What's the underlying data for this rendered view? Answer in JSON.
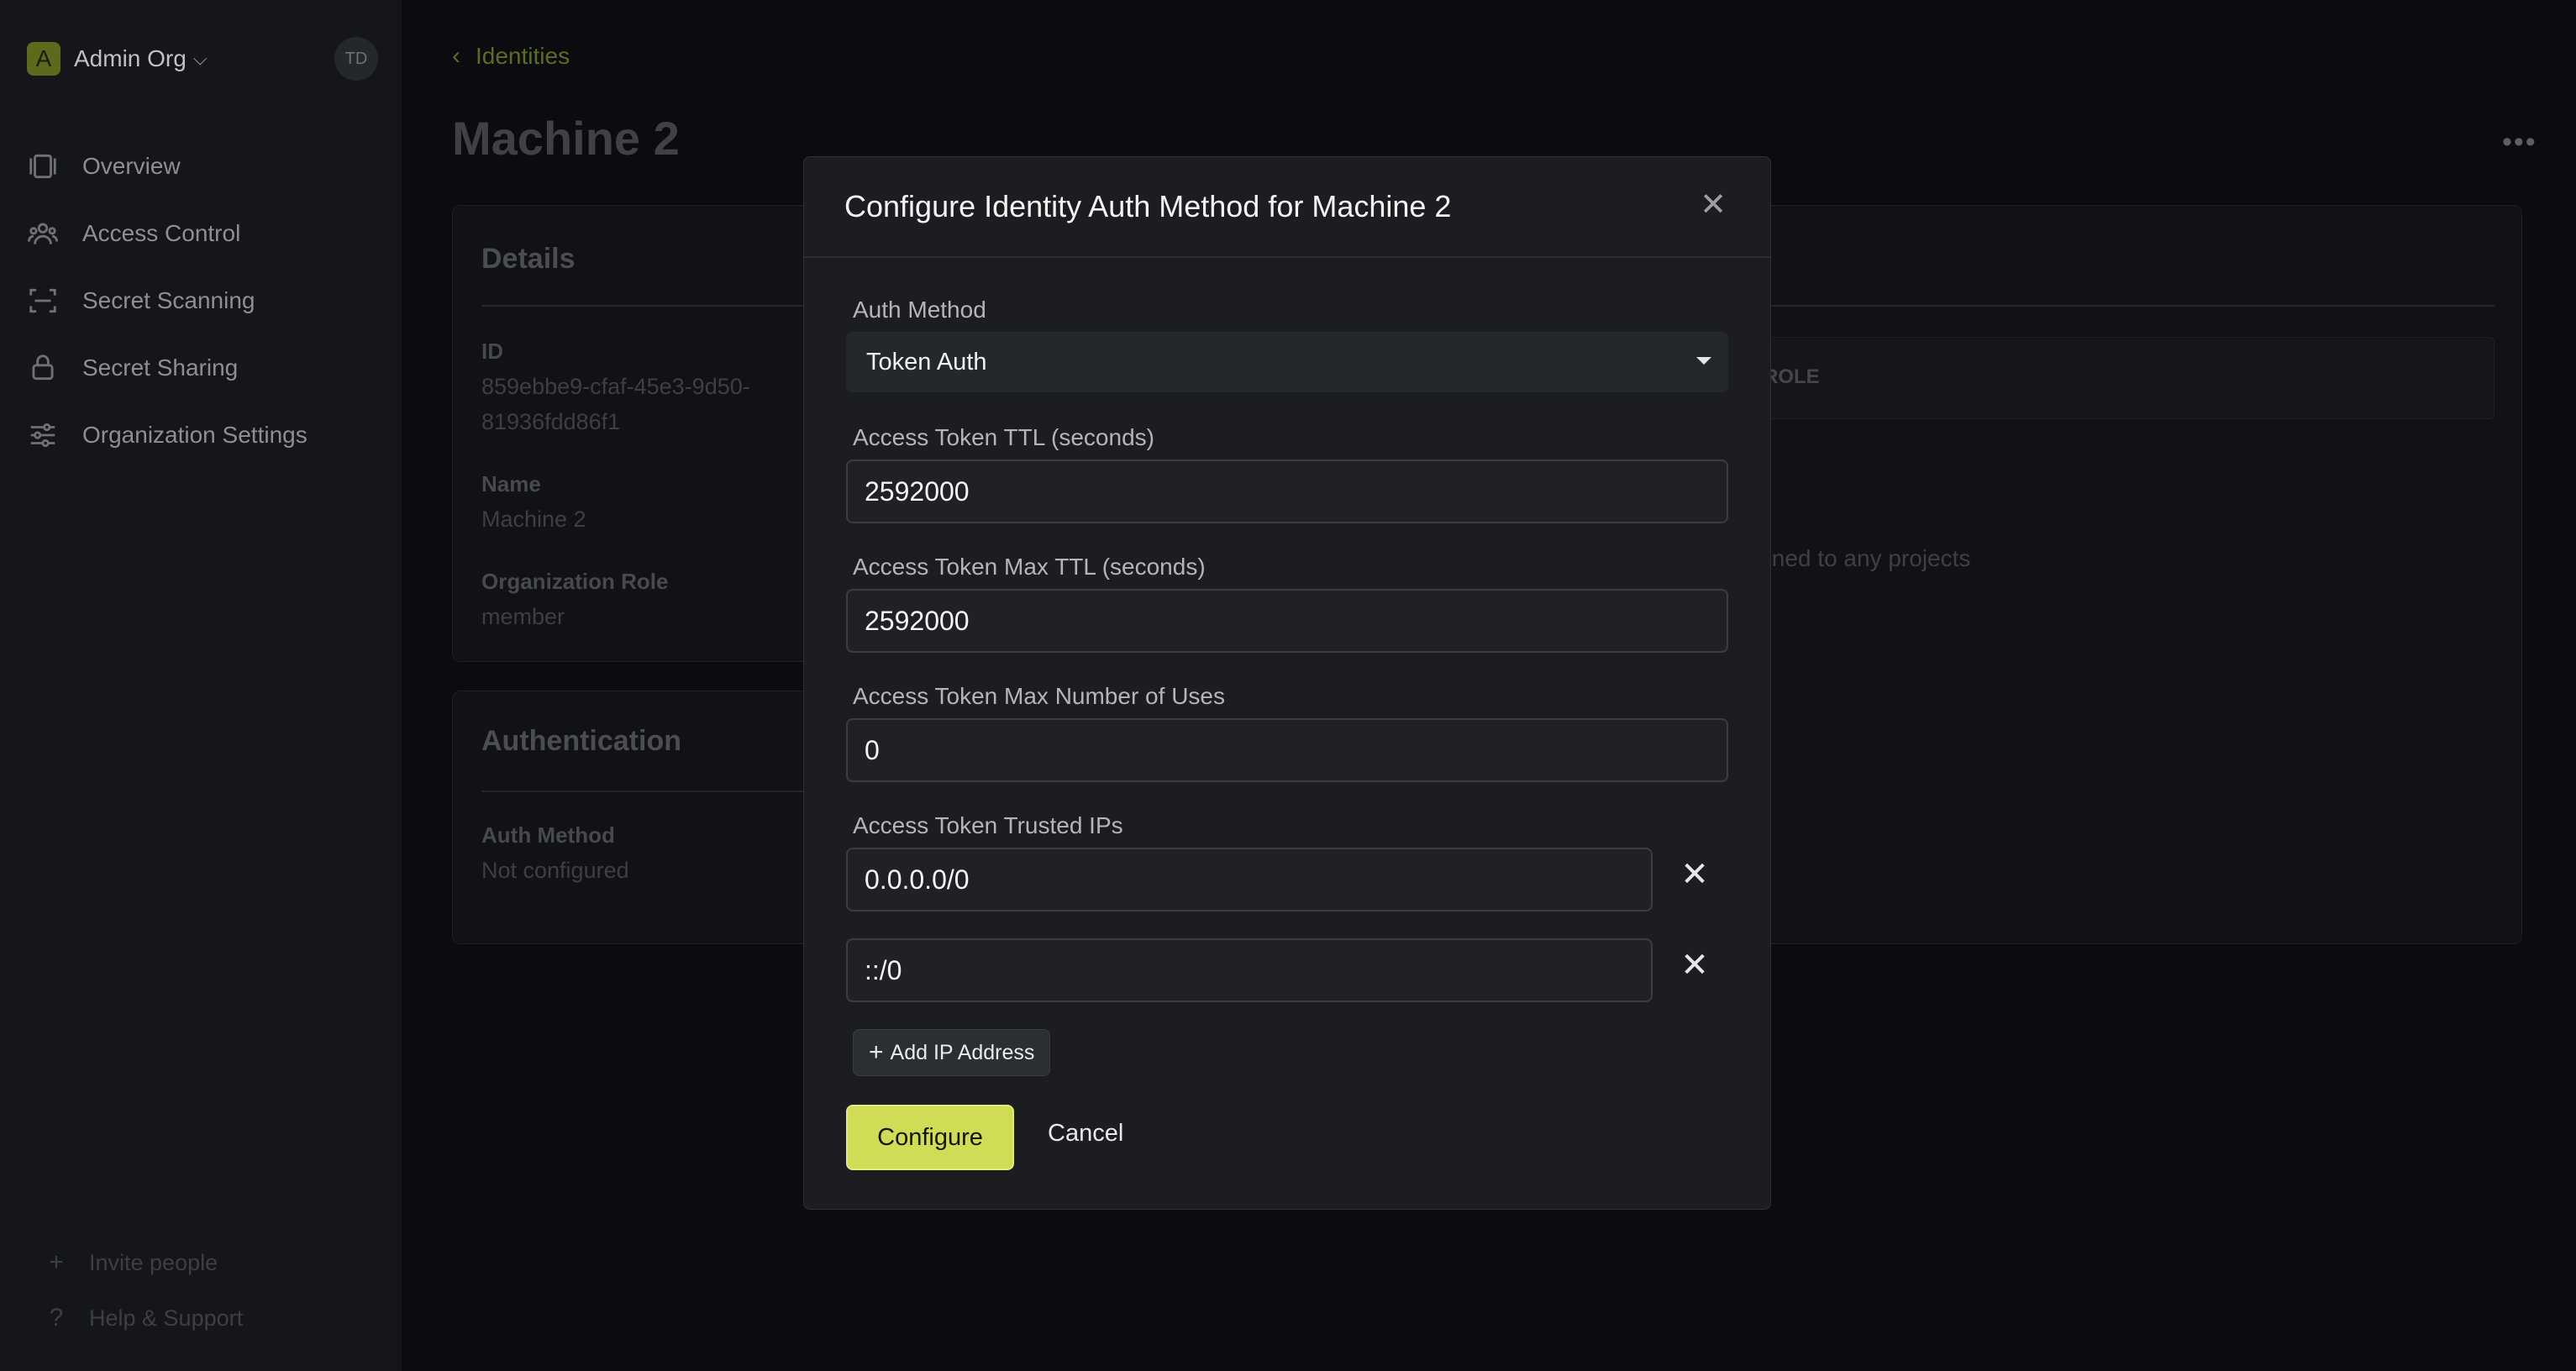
{
  "sidebar": {
    "org_badge": "A",
    "org_name": "Admin Org",
    "user_initials": "TD",
    "items": [
      {
        "label": "Overview",
        "icon": "overview-icon"
      },
      {
        "label": "Access Control",
        "icon": "users-icon"
      },
      {
        "label": "Secret Scanning",
        "icon": "scan-icon"
      },
      {
        "label": "Secret Sharing",
        "icon": "lock-icon"
      },
      {
        "label": "Organization Settings",
        "icon": "sliders-icon"
      }
    ],
    "bottom": [
      {
        "label": "Invite people",
        "icon": "plus-icon"
      },
      {
        "label": "Help & Support",
        "icon": "question-icon"
      }
    ]
  },
  "main": {
    "breadcrumb": "Identities",
    "title": "Machine 2",
    "details": {
      "heading": "Details",
      "id_label": "ID",
      "id_value_1": "859ebbe9-cfaf-45e3-9d50-",
      "id_value_2": "81936fdd86f1",
      "name_label": "Name",
      "name_value": "Machine 2",
      "role_label": "Organization Role",
      "role_value": "member"
    },
    "authentication": {
      "heading": "Authentication",
      "auth_label": "Auth Method",
      "auth_value": "Not configured"
    },
    "projects": {
      "role_column": "ROLE",
      "empty_message": "ssigned to any projects"
    }
  },
  "modal": {
    "title": "Configure Identity Auth Method for Machine 2",
    "auth_method_label": "Auth Method",
    "auth_method_value": "Token Auth",
    "ttl_label": "Access Token TTL (seconds)",
    "ttl_value": "2592000",
    "max_ttl_label": "Access Token Max TTL (seconds)",
    "max_ttl_value": "2592000",
    "max_uses_label": "Access Token Max Number of Uses",
    "max_uses_value": "0",
    "trusted_ips_label": "Access Token Trusted IPs",
    "trusted_ips": [
      "0.0.0.0/0",
      "::/0"
    ],
    "add_ip_label": "Add IP Address",
    "configure_label": "Configure",
    "cancel_label": "Cancel"
  },
  "colors": {
    "accent": "#d0dc56",
    "modal_bg": "#1b1d21",
    "page_bg": "#0b0c0f"
  }
}
